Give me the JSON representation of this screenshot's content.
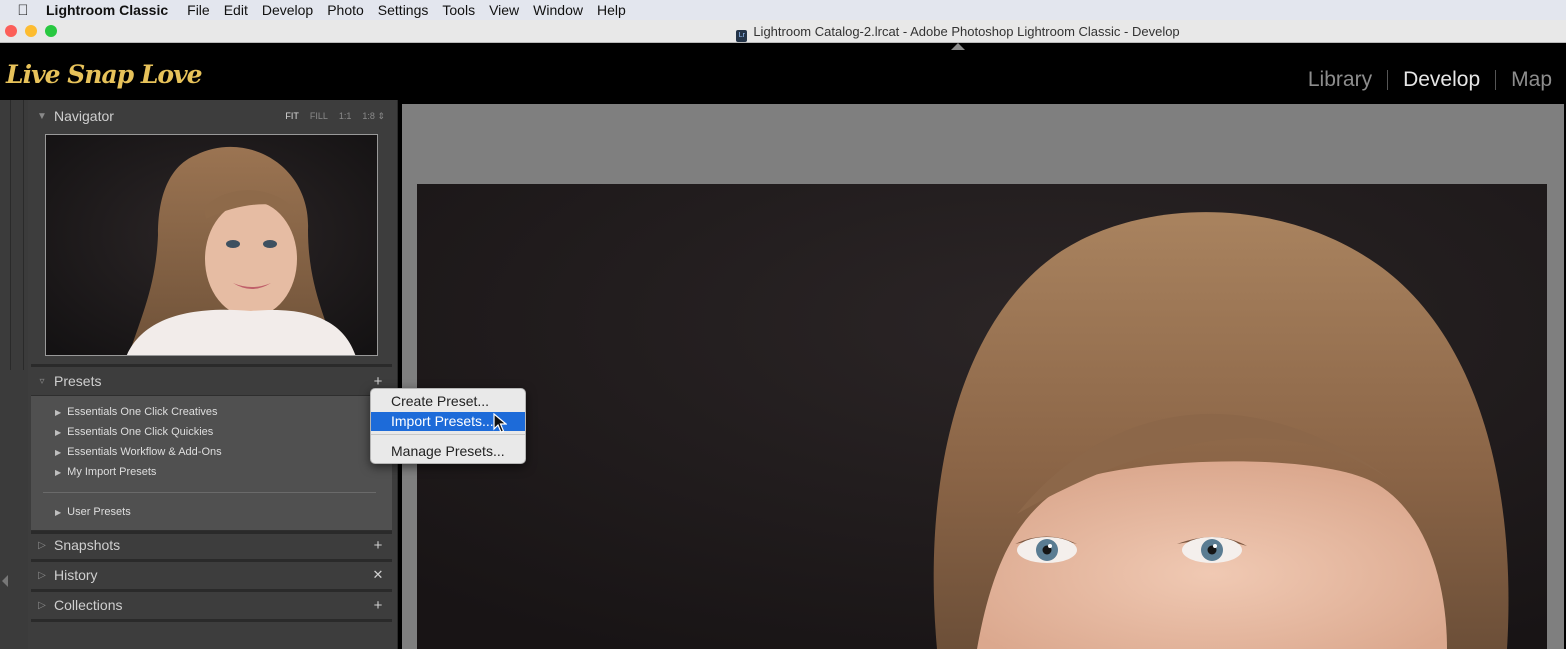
{
  "menubar": {
    "apple_icon": "apple-logo-icon",
    "app_name": "Lightroom Classic",
    "items": [
      "File",
      "Edit",
      "Develop",
      "Photo",
      "Settings",
      "Tools",
      "View",
      "Window",
      "Help"
    ]
  },
  "window": {
    "title": "Lightroom Catalog-2.lrcat - Adobe Photoshop Lightroom Classic - Develop",
    "doc_icon_text": "Lr",
    "traffic_lights": {
      "close": "#fc5f57",
      "minimize": "#fdbc2e",
      "zoom": "#28c840"
    }
  },
  "identity_plate": {
    "text": "Live Snap Love",
    "color": "#e7c25a"
  },
  "modules": {
    "library": "Library",
    "develop": "Develop",
    "map": "Map",
    "active": "Develop"
  },
  "navigator": {
    "title": "Navigator",
    "modes": {
      "fit": "FIT",
      "fill": "FILL",
      "one_to_one": "1:1",
      "custom": "1:8"
    }
  },
  "presets": {
    "title": "Presets",
    "add_icon": "plus-icon",
    "groups": [
      "Essentials One Click Creatives",
      "Essentials One Click Quickies",
      "Essentials Workflow & Add-Ons",
      "My Import Presets"
    ],
    "user_group": "User Presets"
  },
  "panels": {
    "snapshots": "Snapshots",
    "history": "History",
    "collections": "Collections"
  },
  "context_menu": {
    "create": "Create Preset...",
    "import": "Import Presets...",
    "manage": "Manage Presets...",
    "highlighted": "Import Presets..."
  },
  "colors": {
    "panel_bg": "#3d3d3d",
    "canvas_bg": "#7f7f7f",
    "menu_highlight": "#1d6bd9",
    "accent_gold": "#e7c25a"
  }
}
